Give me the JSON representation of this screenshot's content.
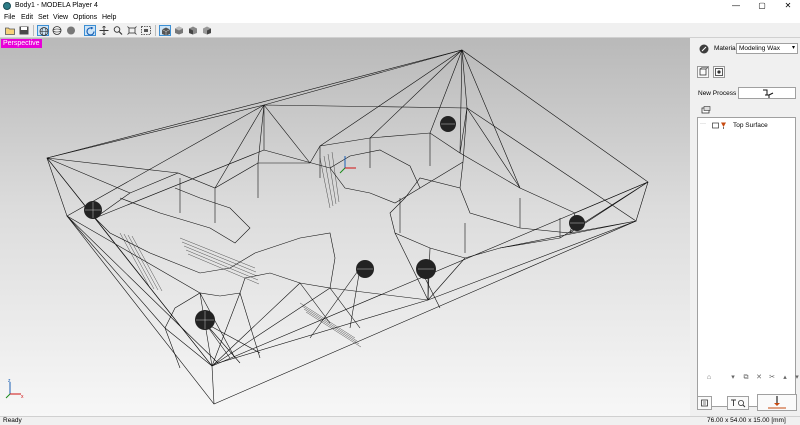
{
  "window": {
    "title": "Body1 - MODELA Player 4",
    "controls": [
      "—",
      "▢",
      "✕"
    ]
  },
  "menu": [
    "File",
    "Edit",
    "Set",
    "View",
    "Options",
    "Help"
  ],
  "toolbar": [
    "open-file-icon",
    "save-icon",
    "view-grid-icon",
    "view-sphere-icon",
    "shade-sphere-icon",
    "rotate-icon",
    "pan-icon",
    "zoom-icon",
    "fit-all-icon",
    "fit-selection-icon",
    "cube-view-1-icon",
    "cube-view-2-icon",
    "cube-view-3-icon",
    "cube-view-4-icon"
  ],
  "viewport": {
    "projection_label": "Perspective",
    "accent": "#e800d8"
  },
  "panel": {
    "material_label": "Material",
    "material_value": "Modeling Wax",
    "new_process_label": "New Process",
    "tree_item": "Top Surface"
  },
  "status": {
    "left": "Ready",
    "right": "76.00 x 54.00 x 15.00 [mm]"
  }
}
